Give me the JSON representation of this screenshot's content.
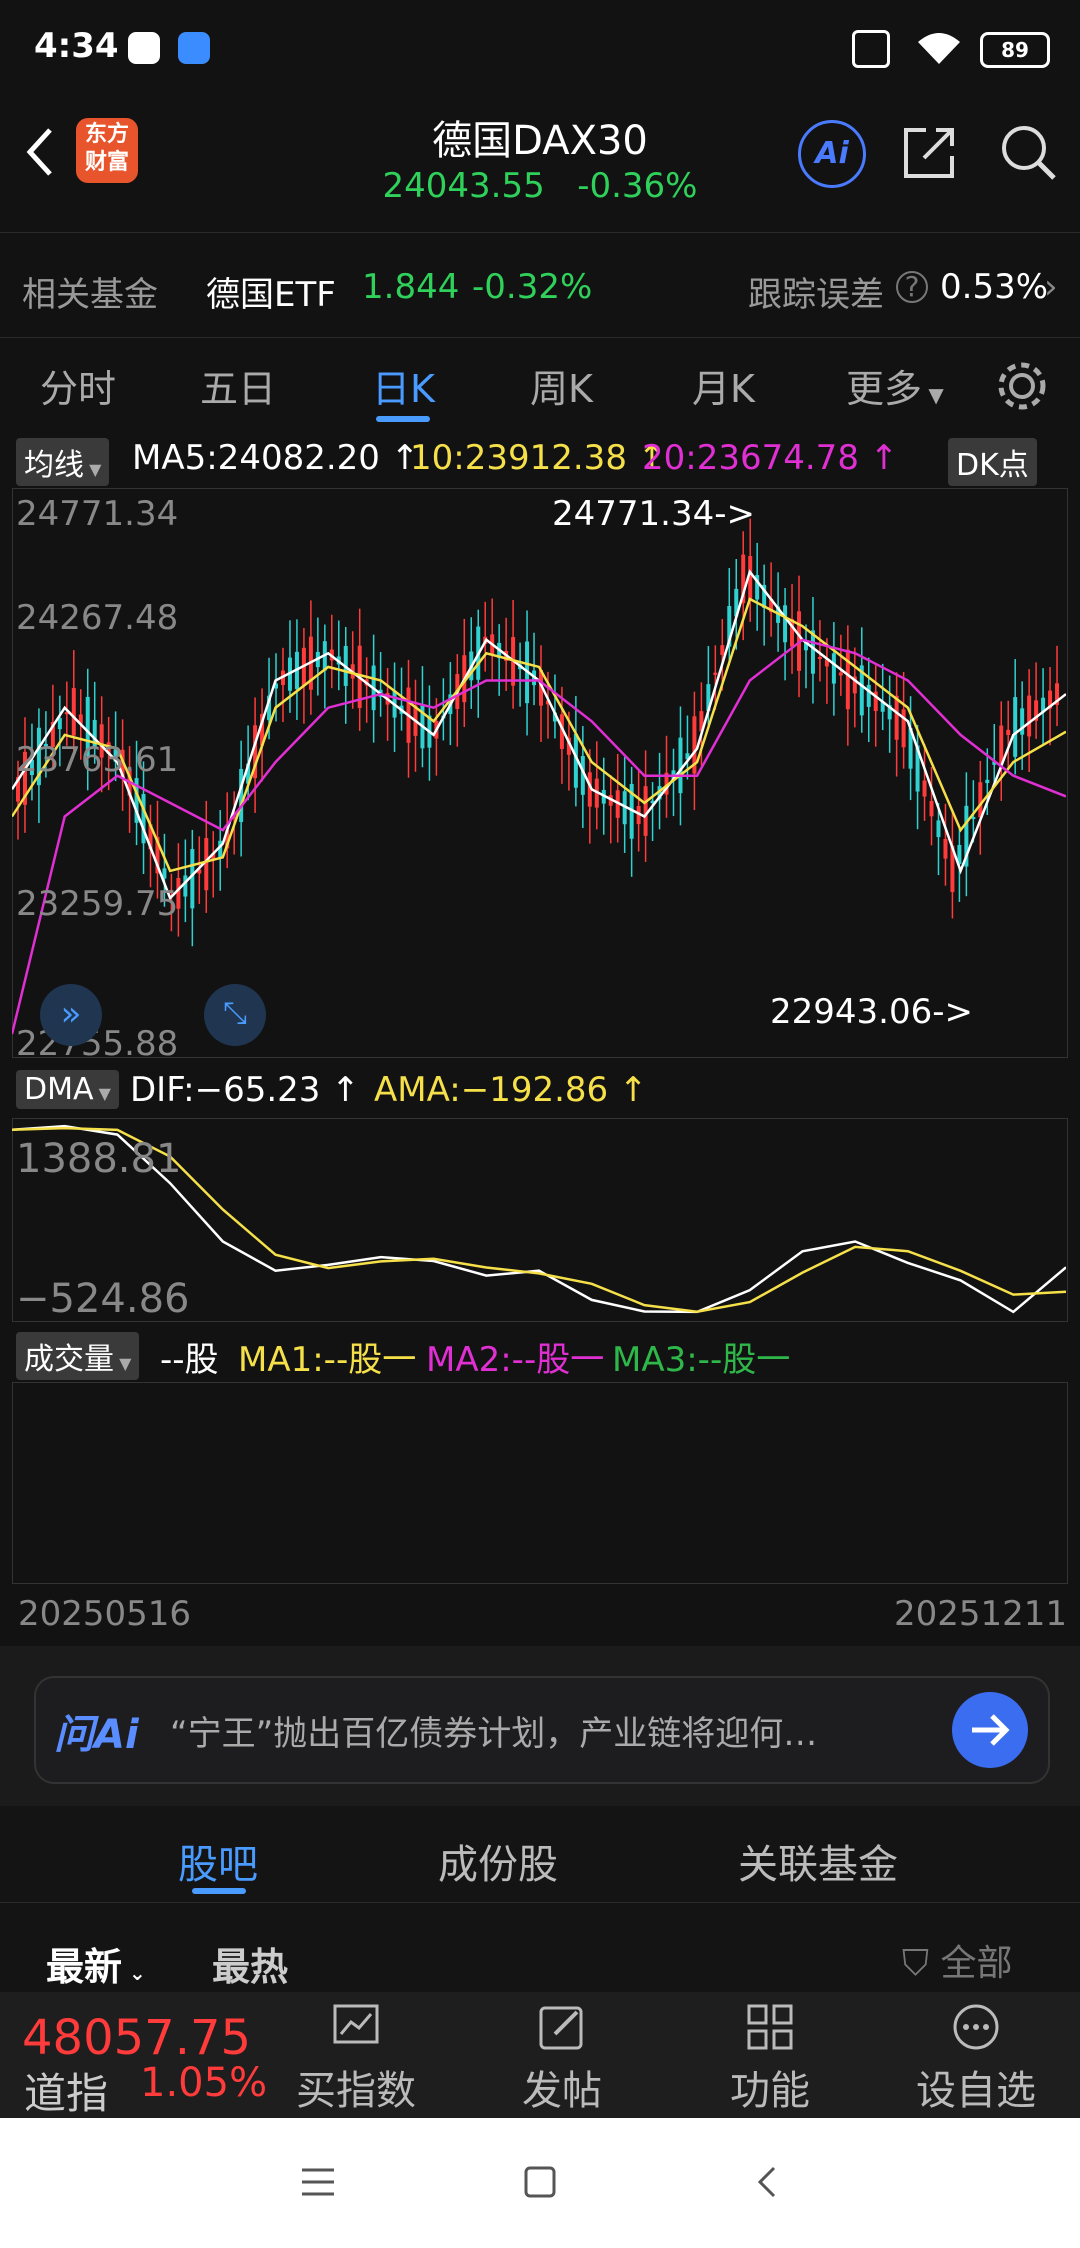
{
  "status": {
    "time": "4:34",
    "battery": "89"
  },
  "header": {
    "title": "德国DAX30",
    "price": "24043.55",
    "change": "-0.36%",
    "logo_text": "东方财富",
    "ai_label": "Ai"
  },
  "fund": {
    "label": "相关基金",
    "name": "德国ETF",
    "price": "1.844",
    "change": "-0.32%",
    "track_label": "跟踪误差",
    "track_value": "0.53%"
  },
  "tabs": [
    "分时",
    "五日",
    "日K",
    "周K",
    "月K",
    "更多"
  ],
  "ma_bar": {
    "label": "均线",
    "ma5": "MA5:24082.20",
    "ma10": "10:23912.38",
    "ma20": "20:23674.78",
    "dk": "DK点"
  },
  "kline": {
    "y_ticks": [
      "24771.34",
      "24267.48",
      "23763.61",
      "23259.75",
      "22755.88"
    ],
    "high_label": "24771.34->",
    "low_label": "22943.06->"
  },
  "dma_bar": {
    "label": "DMA",
    "dif": "DIF:−65.23",
    "ama": "AMA:−192.86"
  },
  "dma": {
    "y_ticks": [
      "1388.81",
      "−524.86"
    ]
  },
  "vol_bar": {
    "label": "成交量",
    "unit": "--股",
    "ma1": "MA1:--股一",
    "ma2": "MA2:--股一",
    "ma3": "MA3:--股一"
  },
  "dates": {
    "start": "20250516",
    "end": "20251211"
  },
  "ai": {
    "logo": "问Ai",
    "text": "“宁王”抛出百亿债券计划，产业链将迎何…"
  },
  "bottom_tabs": [
    "股吧",
    "成份股",
    "关联基金"
  ],
  "sort": {
    "latest": "最新",
    "hot": "最热",
    "filter": "全部"
  },
  "footer": {
    "index_value": "48057.75",
    "index_name": "道指",
    "index_change": "1.05%",
    "buy": "买指数",
    "post": "发帖",
    "func": "功能",
    "watch": "设自选"
  },
  "chart_data": {
    "type": "line",
    "x": [
      "20250516",
      "20251211"
    ],
    "series": [
      {
        "name": "MA5",
        "values": [
          23700,
          24000,
          23800,
          23300,
          23500,
          24100,
          24200,
          24050,
          23900,
          24250,
          24100,
          23700,
          23600,
          23850,
          24500,
          24250,
          24100,
          23950,
          23400,
          23900,
          24050
        ]
      },
      {
        "name": "10",
        "values": [
          23600,
          23900,
          23850,
          23400,
          23450,
          24000,
          24150,
          24100,
          23950,
          24200,
          24150,
          23800,
          23650,
          23800,
          24400,
          24300,
          24150,
          24000,
          23550,
          23800,
          23912
        ]
      },
      {
        "name": "20",
        "values": [
          22800,
          23600,
          23750,
          23650,
          23550,
          23800,
          24000,
          24050,
          24000,
          24100,
          24100,
          23950,
          23750,
          23750,
          24100,
          24250,
          24200,
          24100,
          23900,
          23750,
          23674
        ]
      }
    ],
    "ylim": [
      22755.88,
      24771.34
    ],
    "high": 24771.34,
    "low": 22943.06,
    "dma_ylim": [
      -524.86,
      1388.81
    ]
  }
}
